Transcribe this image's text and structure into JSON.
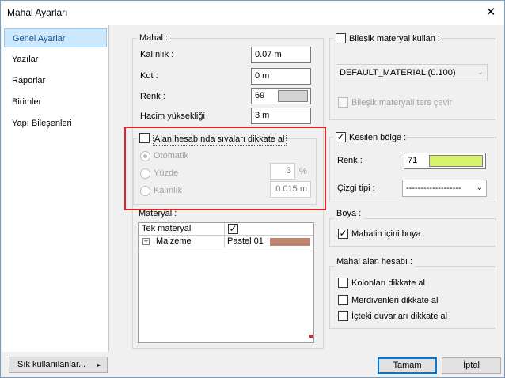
{
  "window": {
    "title": "Mahal Ayarları"
  },
  "sidebar": {
    "items": [
      {
        "label": "Genel Ayarlar",
        "active": true
      },
      {
        "label": "Yazılar"
      },
      {
        "label": "Raporlar"
      },
      {
        "label": "Birimler"
      },
      {
        "label": "Yapı Bileşenleri"
      }
    ]
  },
  "mahal": {
    "group_label": "Mahal :",
    "kalinlik": {
      "label": "Kalınlık :",
      "value": "0.07 m"
    },
    "kot": {
      "label": "Kot :",
      "value": "0 m"
    },
    "renk": {
      "label": "Renk :",
      "value": "69",
      "swatch_color": "#d4d4d4"
    },
    "hacim": {
      "label": "Hacim yüksekliği",
      "value": "3 m"
    }
  },
  "alan": {
    "checkbox_label": "Alan hesabında sıvaları dikkate al",
    "otomatik": "Otomatik",
    "yuzde": {
      "label": "Yüzde",
      "value": "3",
      "unit": "%"
    },
    "kalinlik": {
      "label": "Kalınlık",
      "value": "0.015 m"
    }
  },
  "materyal": {
    "group_label": "Materyal :",
    "tek_materyal": "Tek materyal",
    "malzeme": "Malzeme",
    "pastel": "Pastel 01",
    "pastel_color": "#c0836e"
  },
  "bilesik": {
    "label": "Bileşik materyal kullan :",
    "dropdown_value": "DEFAULT_MATERIAL (0.100)",
    "ters_cevir": "Bileşik materyali ters çevir"
  },
  "kesilen": {
    "label": "Kesilen bölge :",
    "renk_label": "Renk :",
    "renk_value": "71",
    "renk_color": "#d6f26a",
    "cizgi_label": "Çizgi tipi :",
    "cizgi_value": "-------------------"
  },
  "boya": {
    "group_label": "Boya :",
    "mahalin_ici": "Mahalin içini boya"
  },
  "alan_hesabi": {
    "group_label": "Mahal alan hesabı :",
    "kolonlar": "Kolonları dikkate al",
    "merdivenler": "Merdivenleri dikkate al",
    "icteki": "İçteki duvarları dikkate al"
  },
  "footer": {
    "sik": "Sık kullanılanlar...",
    "tamam": "Tamam",
    "iptal": "İptal"
  }
}
